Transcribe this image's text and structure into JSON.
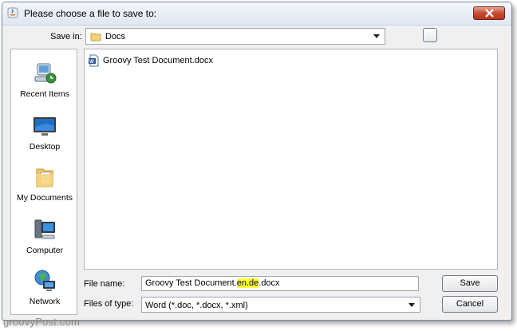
{
  "window": {
    "title": "Please choose a file to save to:"
  },
  "save_in": {
    "label": "Save in:",
    "value": "Docs"
  },
  "places": [
    {
      "label": "Recent Items",
      "icon": "recent-items-icon"
    },
    {
      "label": "Desktop",
      "icon": "desktop-icon"
    },
    {
      "label": "My Documents",
      "icon": "my-documents-icon"
    },
    {
      "label": "Computer",
      "icon": "computer-icon"
    },
    {
      "label": "Network",
      "icon": "network-icon"
    }
  ],
  "files": [
    {
      "name": "Groovy Test Document.docx",
      "icon": "word-document-icon"
    }
  ],
  "file_name": {
    "label": "File name:",
    "value_prefix": "Groovy Test Document.",
    "value_highlight": "en.de",
    "value_suffix": ".docx"
  },
  "file_type": {
    "label": "Files of type:",
    "value": "Word (*.doc, *.docx, *.xml)"
  },
  "buttons": {
    "save": "Save",
    "cancel": "Cancel"
  },
  "watermark": "groovyPost.com",
  "colors": {
    "highlight": "#ffff33",
    "close_button": "#c74a33"
  }
}
